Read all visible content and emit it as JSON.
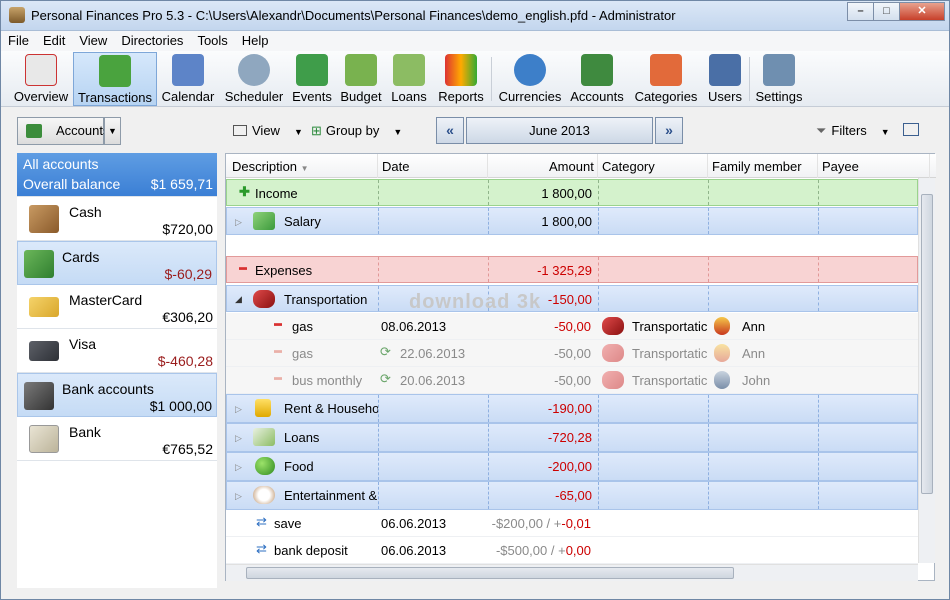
{
  "window": {
    "title": "Personal Finances Pro 5.3 - C:\\Users\\Alexandr\\Documents\\Personal Finances\\demo_english.pfd - Administrator"
  },
  "menu": [
    "File",
    "Edit",
    "View",
    "Directories",
    "Tools",
    "Help"
  ],
  "toolbar": {
    "overview": "Overview",
    "transactions": "Transactions",
    "calendar": "Calendar",
    "scheduler": "Scheduler",
    "events": "Events",
    "budget": "Budget",
    "loans": "Loans",
    "reports": "Reports",
    "currencies": "Currencies",
    "accounts": "Accounts",
    "categories": "Categories",
    "users": "Users",
    "settings": "Settings"
  },
  "subbar": {
    "accounts": "Accounts",
    "view": "View",
    "group_by": "Group by",
    "month": "June 2013",
    "filters": "Filters"
  },
  "left": {
    "all_accounts": "All accounts",
    "overall_balance": "Overall balance",
    "overall_value": "$1 659,71",
    "cash": "Cash",
    "cash_value": "$720,00",
    "cards": "Cards",
    "cards_value": "$-60,29",
    "mastercard": "MasterCard",
    "mastercard_value": "€306,20",
    "visa": "Visa",
    "visa_value": "$-460,28",
    "bank_accounts": "Bank accounts",
    "bank_accounts_value": "$1 000,00",
    "bank": "Bank",
    "bank_value": "€765,52"
  },
  "columns": {
    "description": "Description",
    "date": "Date",
    "amount": "Amount",
    "category": "Category",
    "family_member": "Family member",
    "payee": "Payee"
  },
  "rows": {
    "income": {
      "desc": "Income",
      "amount": "1 800,00"
    },
    "salary": {
      "desc": "Salary",
      "amount": "1 800,00"
    },
    "expenses": {
      "desc": "Expenses",
      "amount": "-1 325,29"
    },
    "transportation": {
      "desc": "Transportation",
      "amount": "-150,00"
    },
    "gas1": {
      "desc": "gas",
      "date": "08.06.2013",
      "amount": "-50,00",
      "category": "Transportatic",
      "member": "Ann"
    },
    "gas2": {
      "desc": "gas",
      "date": "22.06.2013",
      "amount": "-50,00",
      "category": "Transportatic",
      "member": "Ann"
    },
    "bus": {
      "desc": "bus monthly",
      "date": "20.06.2013",
      "amount": "-50,00",
      "category": "Transportatic",
      "member": "John"
    },
    "rent": {
      "desc": "Rent & Househo",
      "amount": "-190,00"
    },
    "loans": {
      "desc": "Loans",
      "amount": "-720,28"
    },
    "food": {
      "desc": "Food",
      "amount": "-200,00"
    },
    "entertainment": {
      "desc": "Entertainment &",
      "amount": "-65,00"
    },
    "save": {
      "desc": "save",
      "date": "06.06.2013",
      "amount_a": "-$200,00 / +",
      "amount_b": "-0,01"
    },
    "deposit": {
      "desc": "bank deposit",
      "date": "06.06.2013",
      "amount_a": "-$500,00 / +",
      "amount_b": "0,00"
    }
  },
  "watermark": "download 3k"
}
